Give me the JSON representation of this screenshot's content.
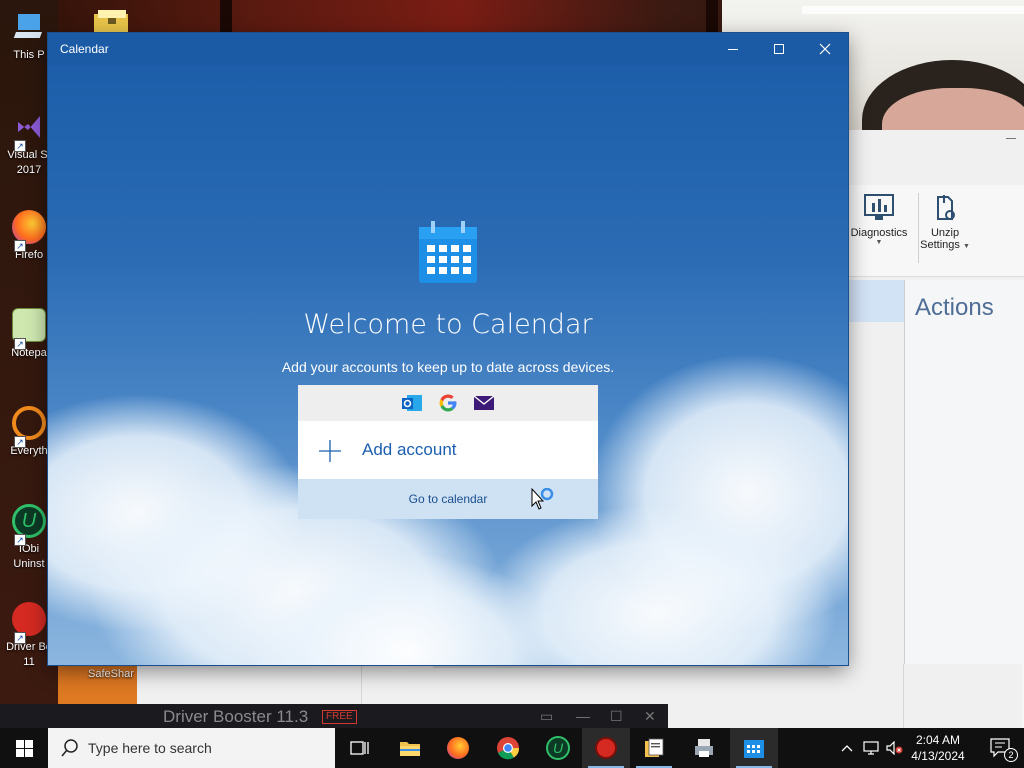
{
  "desktop": {
    "icons": [
      {
        "label": "This P",
        "name": "desktop-icon-this-pc"
      },
      {
        "label": "Visual St\n2017",
        "name": "desktop-icon-visual-studio"
      },
      {
        "label": "Firefo",
        "name": "desktop-icon-firefox"
      },
      {
        "label": "Notepa",
        "name": "desktop-icon-notepad"
      },
      {
        "label": "Everyth",
        "name": "desktop-icon-everything"
      },
      {
        "label": "IObi\nUninst",
        "name": "desktop-icon-iobit-uninstaller"
      },
      {
        "label": "Driver Bo\n11",
        "name": "desktop-icon-driver-booster"
      }
    ],
    "safeshare_label": "SafeShar"
  },
  "background_app": {
    "ribbon": {
      "diagnostics_label": "Diagnostics",
      "unzip_label": "Unzip",
      "settings_label": "Settings"
    },
    "actions_title": "Actions"
  },
  "driver_booster": {
    "title": "Driver Booster 11.3",
    "badge": "FREE"
  },
  "calendar_window": {
    "title": "Calendar",
    "welcome": "Welcome to Calendar",
    "subtitle": "Add your accounts to keep up to date across devices.",
    "add_account": "Add account",
    "go_to_calendar": "Go to calendar"
  },
  "taskbar": {
    "search_placeholder": "Type here to search",
    "apps": [
      "task-view",
      "file-explorer",
      "firefox",
      "chrome",
      "iobit-uninstaller",
      "driver-booster",
      "file-manager",
      "printer-app",
      "calendar"
    ],
    "time": "2:04 AM",
    "date": "4/13/2024",
    "notification_count": "2"
  },
  "colors": {
    "accent": "#1b5ba6",
    "card_link": "#1b5fb0",
    "goto_bg": "#cfe2f4",
    "taskbar": "#101010"
  }
}
